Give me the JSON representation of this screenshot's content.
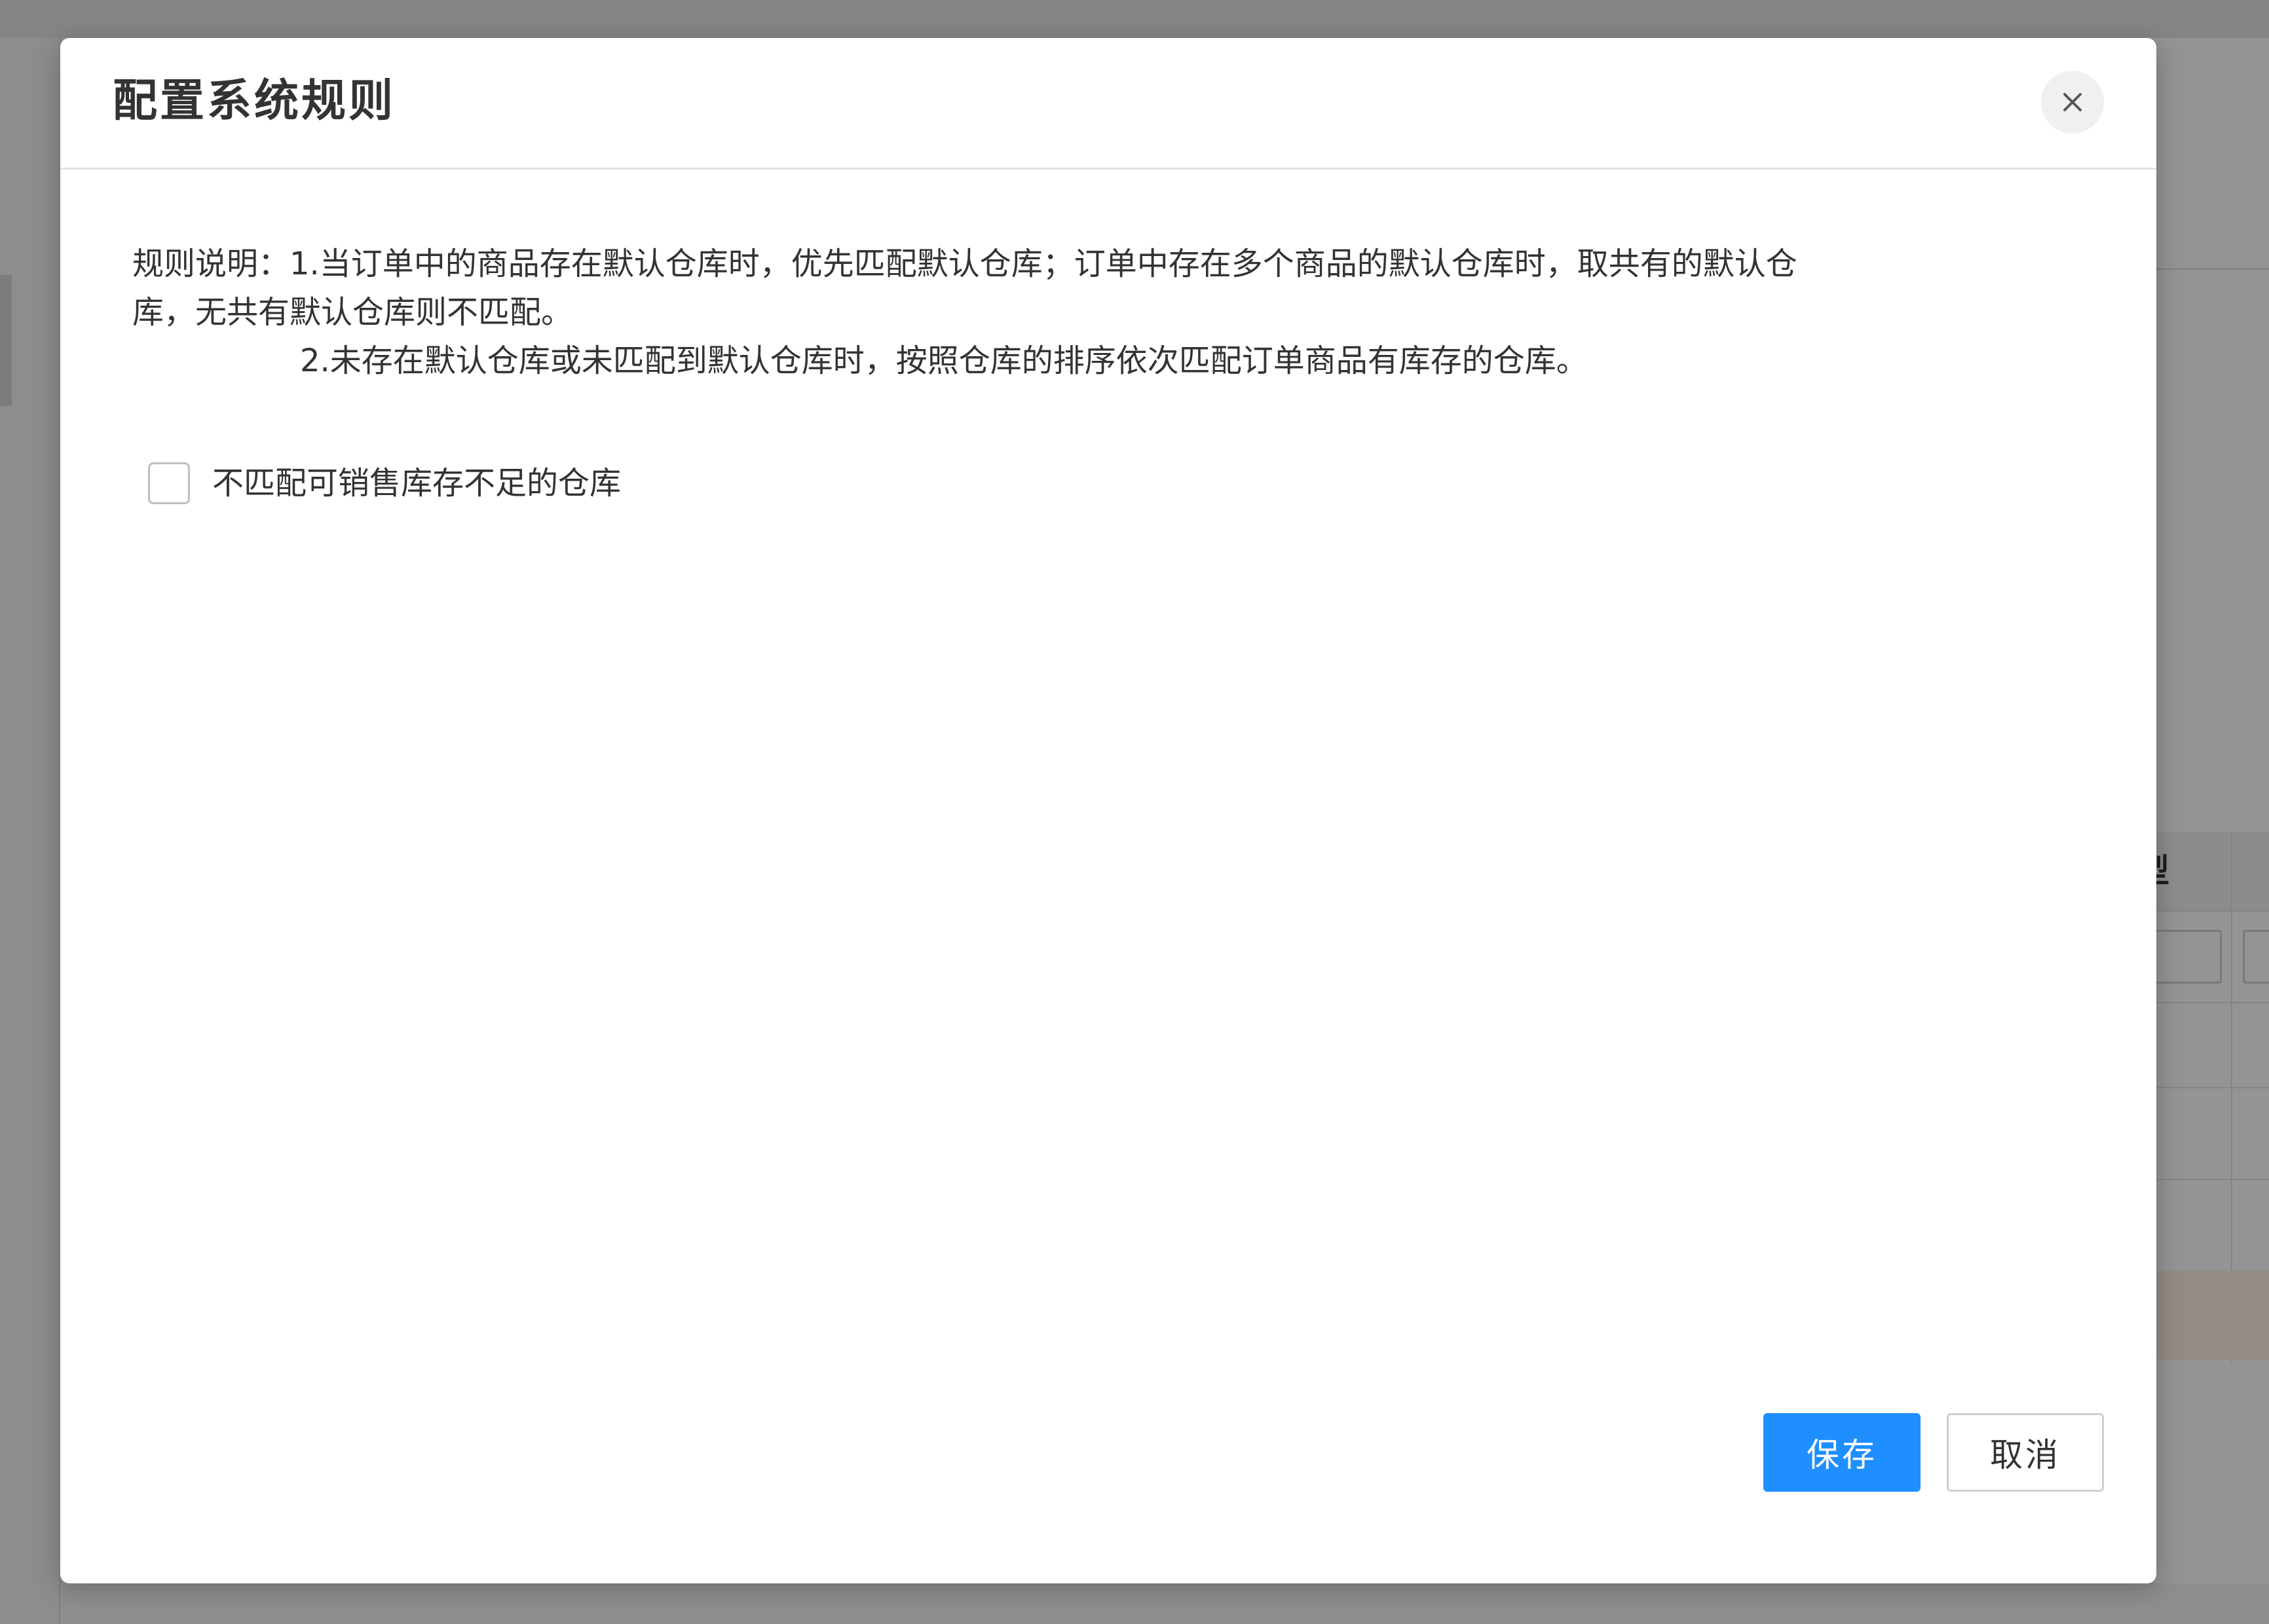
{
  "background": {
    "table_header_fragment": "型"
  },
  "dialog": {
    "title": "配置系统规则",
    "close_icon": "close-icon",
    "rules": {
      "line1": "规则说明：1.当订单中的商品存在默认仓库时，优先匹配默认仓库；订单中存在多个商品的默认仓库时，取共有的默认仓",
      "line2": "库，无共有默认仓库则不匹配。",
      "line3": "2.未存在默认仓库或未匹配到默认仓库时，按照仓库的排序依次匹配订单商品有库存的仓库。"
    },
    "checkbox": {
      "label": "不匹配可销售库存不足的仓库",
      "checked": false
    },
    "buttons": {
      "save_label": "保存",
      "cancel_label": "取消"
    }
  },
  "colors": {
    "primary": "#1f8fff",
    "text": "#333333",
    "overlay": "rgba(0,0,0,0.42)"
  }
}
